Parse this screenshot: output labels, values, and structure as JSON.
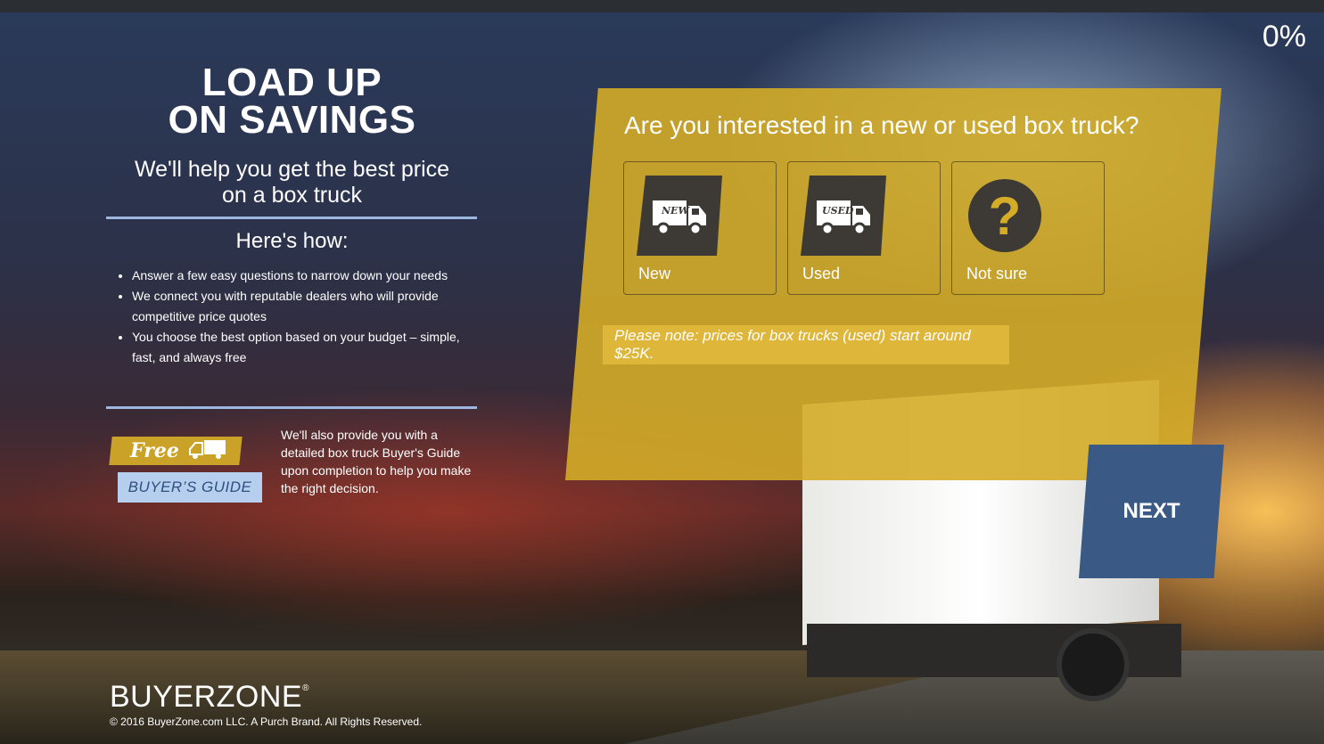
{
  "progress": "0%",
  "hero": {
    "title_line1": "LOAD UP",
    "title_line2": "ON SAVINGS",
    "subtitle_line1": "We'll help you get the best price",
    "subtitle_line2": "on a box truck",
    "hows_heading": "Here's how:",
    "steps": [
      "Answer a few easy questions to narrow down your needs",
      "We connect you with reputable dealers who will provide competitive price quotes",
      "You choose the best option based on your budget – simple, fast, and always free"
    ]
  },
  "guide": {
    "badge_free": "Free",
    "badge_title": "BUYER’S GUIDE",
    "text": "We'll also provide you with a detailed box truck Buyer's Guide upon completion to help you make the right decision."
  },
  "quiz": {
    "question": "Are you interested in a new or used box truck?",
    "options": [
      {
        "label": "New",
        "icon": "new-truck-icon",
        "icon_text": "NEW"
      },
      {
        "label": "Used",
        "icon": "used-truck-icon",
        "icon_text": "USED"
      },
      {
        "label": "Not sure",
        "icon": "question-icon",
        "icon_text": "?"
      }
    ],
    "note": "Please note: prices for box trucks (used) start around $25K.",
    "next_label": "NEXT"
  },
  "footer": {
    "logo": "BUYERZONE",
    "trademark": "®",
    "copyright": "© 2016 BuyerZone.com LLC. A Purch Brand. All Rights Reserved."
  },
  "colors": {
    "card": "#D4AC28",
    "next": "#3A5A85",
    "icon_dark": "#3D3A35",
    "guide_gold": "#C9A227",
    "guide_blue": "#B7CFEE",
    "rule": "#9DB8E0"
  }
}
